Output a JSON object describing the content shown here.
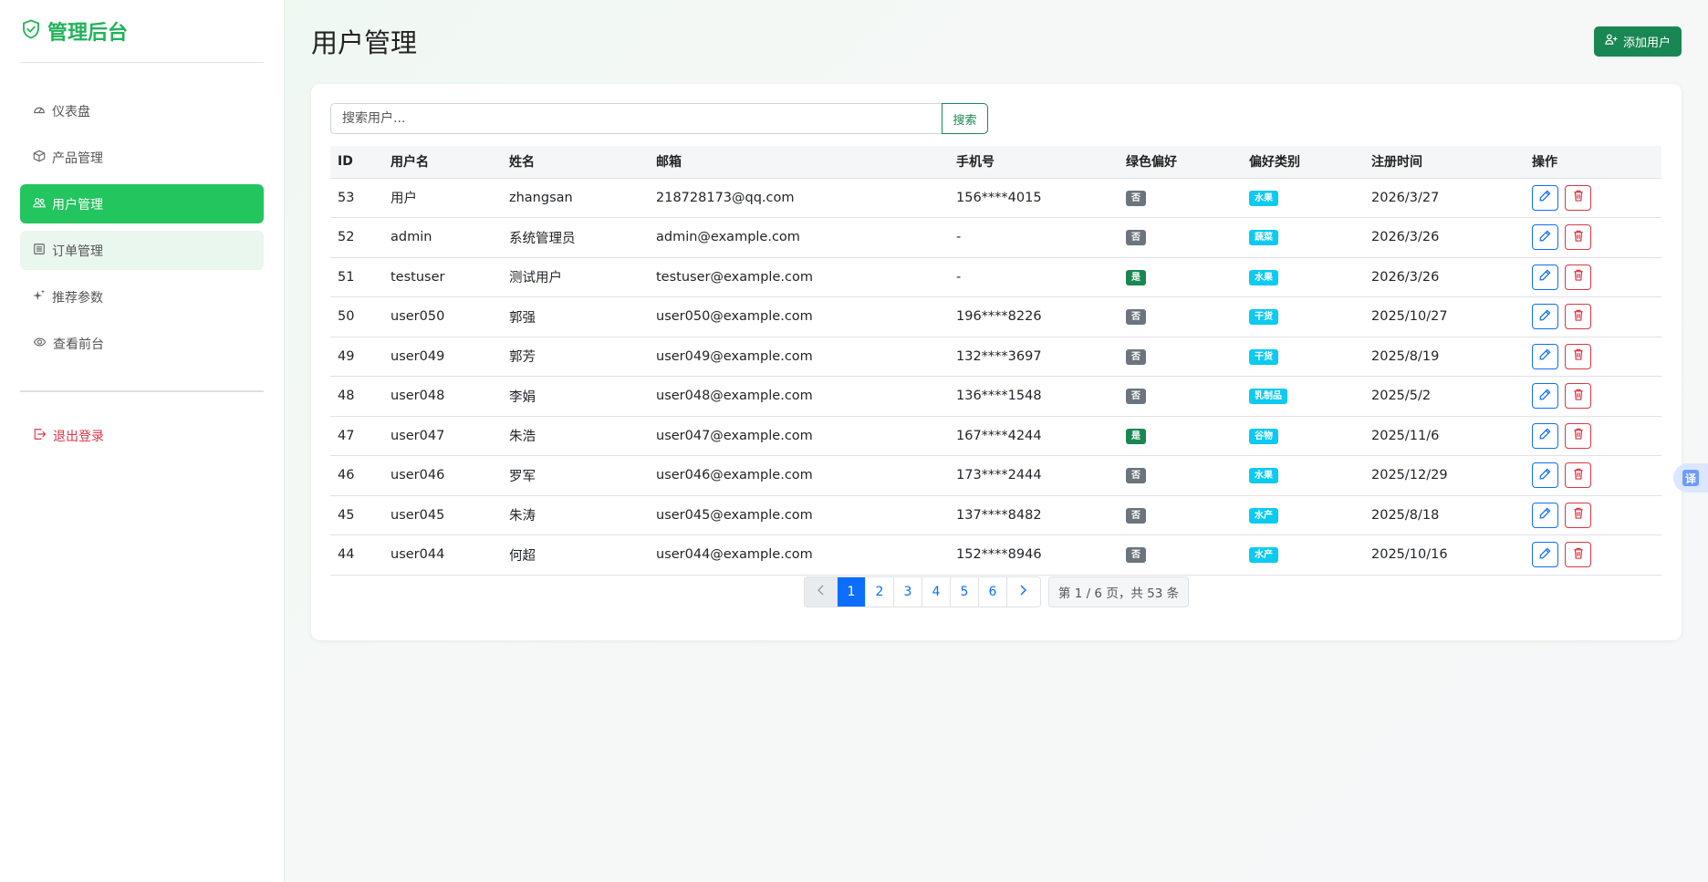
{
  "brand": {
    "title": "管理后台",
    "color": "#22b35a"
  },
  "sidebar": {
    "items": [
      {
        "label": "仪表盘",
        "icon": "speedometer-icon"
      },
      {
        "label": "产品管理",
        "icon": "box-icon"
      },
      {
        "label": "用户管理",
        "icon": "people-icon",
        "active": true
      },
      {
        "label": "订单管理",
        "icon": "list-icon"
      },
      {
        "label": "推荐参数",
        "icon": "sparkle-icon"
      },
      {
        "label": "查看前台",
        "icon": "eye-icon"
      }
    ],
    "logout": "退出登录"
  },
  "header": {
    "title": "用户管理",
    "add_label": "添加用户"
  },
  "search": {
    "placeholder": "搜索用户...",
    "button": "搜索"
  },
  "table": {
    "columns": [
      "ID",
      "用户名",
      "姓名",
      "邮箱",
      "手机号",
      "绿色偏好",
      "偏好类别",
      "注册时间",
      "操作"
    ],
    "rows": [
      {
        "id": "53",
        "username": "用户",
        "name": "zhangsan",
        "email": "218728173@qq.com",
        "phone": "156****4015",
        "green": "否",
        "category": "水果",
        "date": "2026/3/27"
      },
      {
        "id": "52",
        "username": "admin",
        "name": "系统管理员",
        "email": "admin@example.com",
        "phone": "-",
        "green": "否",
        "category": "蔬菜",
        "date": "2026/3/26"
      },
      {
        "id": "51",
        "username": "testuser",
        "name": "测试用户",
        "email": "testuser@example.com",
        "phone": "-",
        "green": "是",
        "category": "水果",
        "date": "2026/3/26"
      },
      {
        "id": "50",
        "username": "user050",
        "name": "郭强",
        "email": "user050@example.com",
        "phone": "196****8226",
        "green": "否",
        "category": "干货",
        "date": "2025/10/27"
      },
      {
        "id": "49",
        "username": "user049",
        "name": "郭芳",
        "email": "user049@example.com",
        "phone": "132****3697",
        "green": "否",
        "category": "干货",
        "date": "2025/8/19"
      },
      {
        "id": "48",
        "username": "user048",
        "name": "李娟",
        "email": "user048@example.com",
        "phone": "136****1548",
        "green": "否",
        "category": "乳制品",
        "date": "2025/5/2"
      },
      {
        "id": "47",
        "username": "user047",
        "name": "朱浩",
        "email": "user047@example.com",
        "phone": "167****4244",
        "green": "是",
        "category": "谷物",
        "date": "2025/11/6"
      },
      {
        "id": "46",
        "username": "user046",
        "name": "罗军",
        "email": "user046@example.com",
        "phone": "173****2444",
        "green": "否",
        "category": "水果",
        "date": "2025/12/29"
      },
      {
        "id": "45",
        "username": "user045",
        "name": "朱涛",
        "email": "user045@example.com",
        "phone": "137****8482",
        "green": "否",
        "category": "水产",
        "date": "2025/8/18"
      },
      {
        "id": "44",
        "username": "user044",
        "name": "何超",
        "email": "user044@example.com",
        "phone": "152****8946",
        "green": "否",
        "category": "水产",
        "date": "2025/10/16"
      }
    ]
  },
  "pagination": {
    "pages": [
      "1",
      "2",
      "3",
      "4",
      "5",
      "6"
    ],
    "current": "1",
    "info": "第 1 / 6 页，共 53 条"
  },
  "translate": {
    "label": "译"
  },
  "colors": {
    "accent": "#22c55e",
    "primary": "#0d6efd",
    "danger": "#dc3545",
    "success": "#198754",
    "info": "#0dcaf0"
  }
}
